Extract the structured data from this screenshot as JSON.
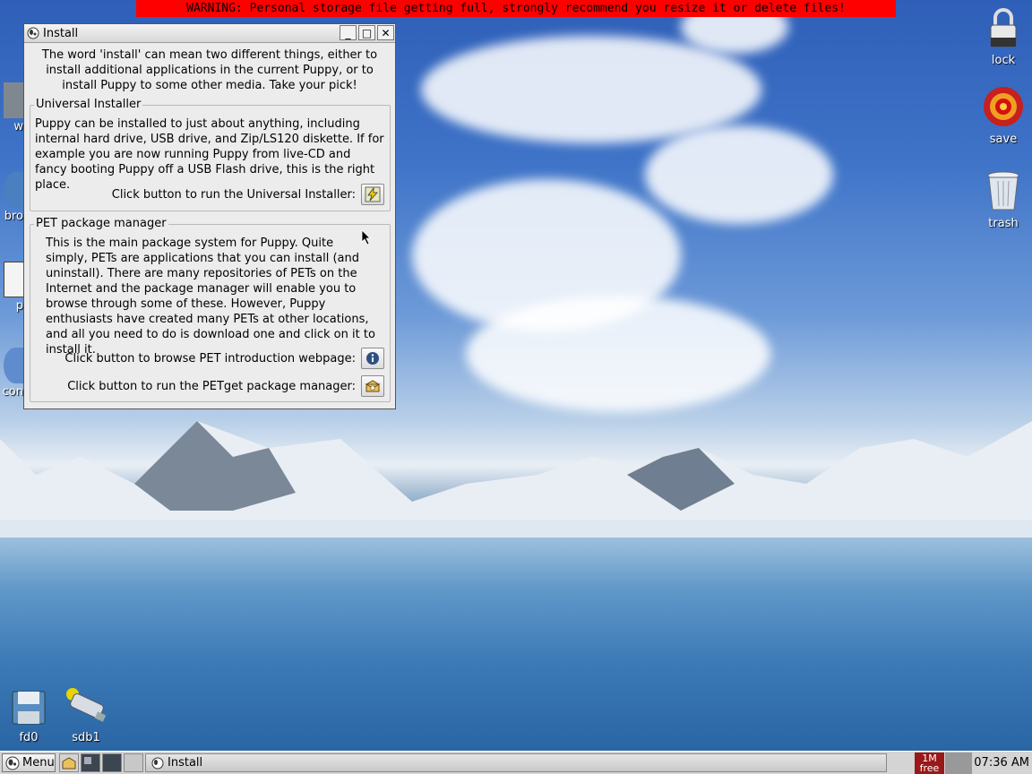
{
  "warning": "WARNING: Personal storage file getting full, strongly recommend you resize it or delete files!",
  "desktop_icons": {
    "lock": "lock",
    "save": "save",
    "trash": "trash",
    "fd0": "fd0",
    "sdb1": "sdb1",
    "partial_left": [
      "w",
      "bro",
      "p",
      "con"
    ]
  },
  "window": {
    "title": "Install",
    "minimize_glyph": "_",
    "maximize_glyph": "□",
    "close_glyph": "✕",
    "intro": "The word 'install' can mean two different things, either to install additional applications in the current Puppy, or to install Puppy to some other media. Take your pick!",
    "universal": {
      "title": "Universal Installer",
      "text": "Puppy can be installed to just about anything, including internal hard drive, USB drive, and Zip/LS120 diskette. If for example you are now running Puppy from live-CD and fancy booting Puppy off a USB Flash drive, this is the right place.",
      "button_label": "Click button to run the Universal Installer:"
    },
    "pet": {
      "title": "PET package manager",
      "text": "This is the main package system for Puppy. Quite simply, PETs are applications that you can install (and uninstall). There are many repositories of PETs on the Internet and the package manager will enable you to browse through some of these. However, Puppy enthusiasts have created many PETs at other locations, and all you need to do is download one and click on it to install it.",
      "browse_label": "Click button to browse PET introduction webpage:",
      "run_label": "Click button to run the PETget package manager:"
    }
  },
  "taskbar": {
    "menu_label": "Menu",
    "task_label": "Install",
    "mem_line1": "1M",
    "mem_line2": "free",
    "clock": "07:36 AM"
  }
}
